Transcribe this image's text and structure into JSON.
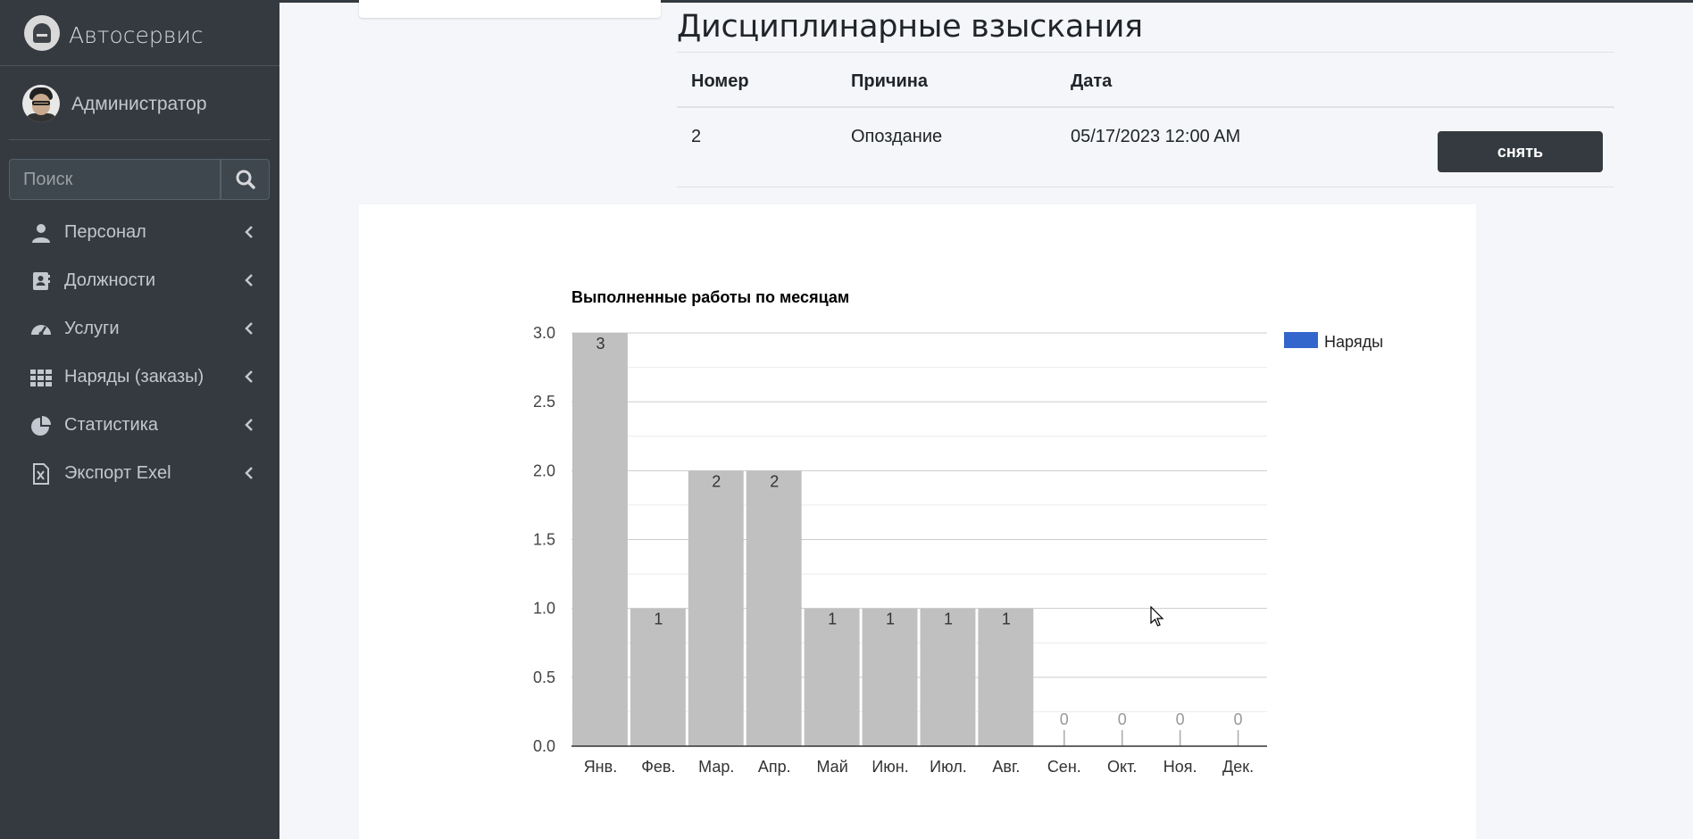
{
  "app": {
    "brand": "Автосервис"
  },
  "user": {
    "name": "Администратор"
  },
  "search": {
    "placeholder": "Поиск"
  },
  "sidebar": {
    "items": [
      {
        "label": "Персонал",
        "icon": "user-icon"
      },
      {
        "label": "Должности",
        "icon": "id-card-icon"
      },
      {
        "label": "Услуги",
        "icon": "tachometer-icon"
      },
      {
        "label": "Наряды (заказы)",
        "icon": "grid-icon"
      },
      {
        "label": "Статистика",
        "icon": "pie-chart-icon"
      },
      {
        "label": "Экспорт Exel",
        "icon": "excel-file-icon"
      }
    ]
  },
  "discipline": {
    "title": "Дисциплинарные взыскания",
    "headers": {
      "number": "Номер",
      "reason": "Причина",
      "date": "Дата"
    },
    "rows": [
      {
        "number": "2",
        "reason": "Опоздание",
        "date": "05/17/2023 12:00 AM",
        "action": "снять"
      }
    ]
  },
  "colors": {
    "sidebar": "#343a40",
    "bar": "#c0c0c0",
    "legend": "#3366cc"
  },
  "chart_data": {
    "type": "bar",
    "title": "Выполненные работы по месяцам",
    "categories": [
      "Янв.",
      "Фев.",
      "Мар.",
      "Апр.",
      "Май",
      "Июн.",
      "Июл.",
      "Авг.",
      "Сен.",
      "Окт.",
      "Ноя.",
      "Дек."
    ],
    "series": [
      {
        "name": "Наряды",
        "values": [
          3,
          1,
          2,
          2,
          1,
          1,
          1,
          1,
          0,
          0,
          0,
          0
        ]
      }
    ],
    "yticks": [
      "0.0",
      "0.5",
      "1.0",
      "1.5",
      "2.0",
      "2.5",
      "3.0"
    ],
    "ylim": [
      0,
      3
    ],
    "grid": true,
    "legend": "right"
  }
}
